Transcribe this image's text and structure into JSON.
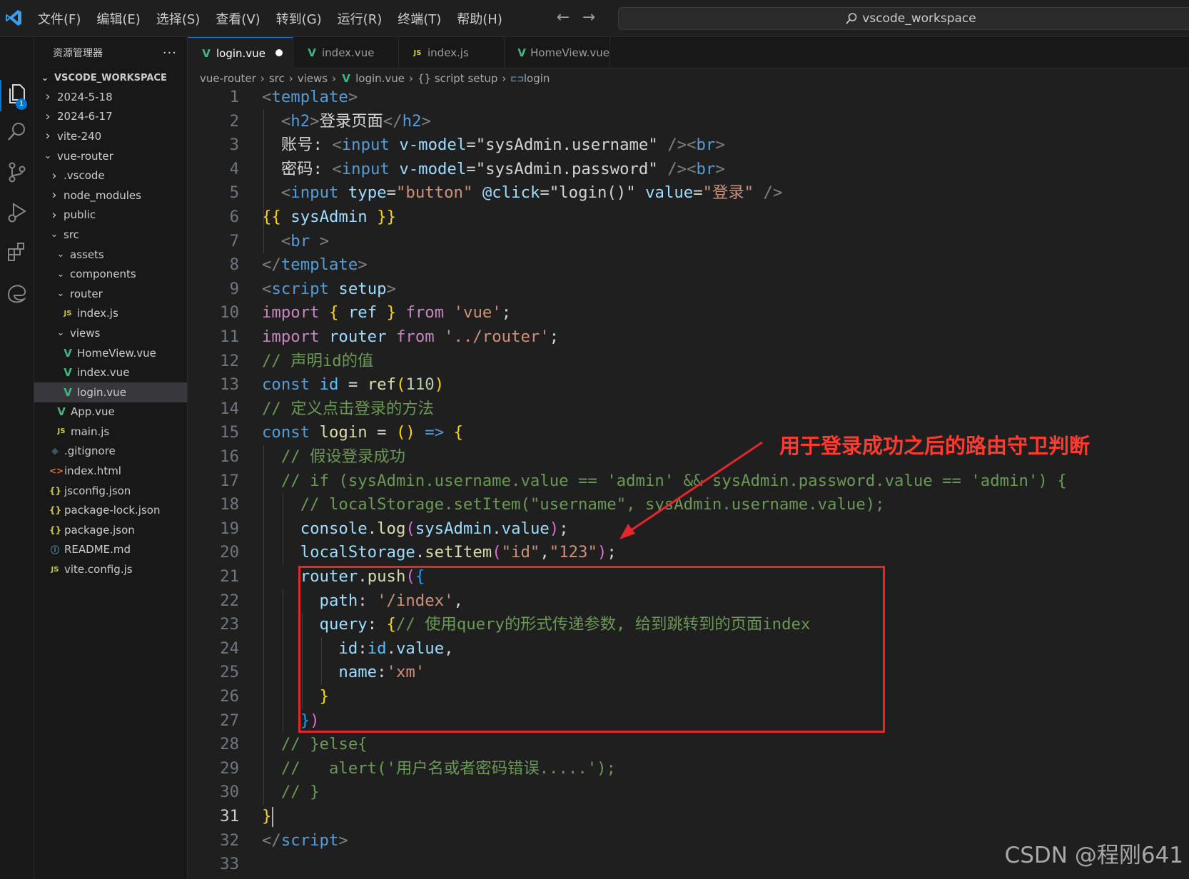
{
  "menu": [
    "文件(F)",
    "编辑(E)",
    "选择(S)",
    "查看(V)",
    "转到(G)",
    "运行(R)",
    "终端(T)",
    "帮助(H)"
  ],
  "search": {
    "text": "vscode_workspace"
  },
  "activity": {
    "explorer_badge": "1"
  },
  "sidebar": {
    "title": "资源管理器",
    "more": "···",
    "workspace": "VSCODE_WORKSPACE",
    "tree": [
      {
        "label": "2024-5-18",
        "depth": 1,
        "chev": "right"
      },
      {
        "label": "2024-6-17",
        "depth": 1,
        "chev": "right"
      },
      {
        "label": "vite-240",
        "depth": 1,
        "chev": "right"
      },
      {
        "label": "vue-router",
        "depth": 1,
        "chev": "down"
      },
      {
        "label": ".vscode",
        "depth": 2,
        "chev": "right"
      },
      {
        "label": "node_modules",
        "depth": 2,
        "chev": "right"
      },
      {
        "label": "public",
        "depth": 2,
        "chev": "right"
      },
      {
        "label": "src",
        "depth": 2,
        "chev": "down"
      },
      {
        "label": "assets",
        "depth": 3,
        "chev": "down"
      },
      {
        "label": "components",
        "depth": 3,
        "chev": "down"
      },
      {
        "label": "router",
        "depth": 3,
        "chev": "down"
      },
      {
        "label": "index.js",
        "depth": 4,
        "icon": "js"
      },
      {
        "label": "views",
        "depth": 3,
        "chev": "down"
      },
      {
        "label": "HomeView.vue",
        "depth": 4,
        "icon": "vue"
      },
      {
        "label": "index.vue",
        "depth": 4,
        "icon": "vue"
      },
      {
        "label": "login.vue",
        "depth": 4,
        "icon": "vue",
        "selected": true
      },
      {
        "label": "App.vue",
        "depth": 3,
        "icon": "vue"
      },
      {
        "label": "main.js",
        "depth": 3,
        "icon": "js"
      },
      {
        "label": ".gitignore",
        "depth": 2,
        "icon": "git"
      },
      {
        "label": "index.html",
        "depth": 2,
        "icon": "html"
      },
      {
        "label": "jsconfig.json",
        "depth": 2,
        "icon": "json"
      },
      {
        "label": "package-lock.json",
        "depth": 2,
        "icon": "json"
      },
      {
        "label": "package.json",
        "depth": 2,
        "icon": "json"
      },
      {
        "label": "README.md",
        "depth": 2,
        "icon": "md"
      },
      {
        "label": "vite.config.js",
        "depth": 2,
        "icon": "js"
      }
    ]
  },
  "tabs": [
    {
      "label": "login.vue",
      "icon": "vue",
      "active": true,
      "dirty": true
    },
    {
      "label": "index.vue",
      "icon": "vue"
    },
    {
      "label": "index.js",
      "icon": "js"
    },
    {
      "label": "HomeView.vue",
      "icon": "vue"
    }
  ],
  "breadcrumb": [
    "vue-router",
    "src",
    "views",
    "login.vue",
    "{} script setup",
    "login"
  ],
  "editor": {
    "current_line": 31,
    "lines": [
      [
        [
          "t-pun",
          "<"
        ],
        [
          "t-tag",
          "template"
        ],
        [
          "t-pun",
          ">"
        ]
      ],
      [
        [
          "",
          "  "
        ],
        [
          "t-pun",
          "<"
        ],
        [
          "t-tag",
          "h2"
        ],
        [
          "t-pun",
          ">"
        ],
        [
          "t-txt",
          "登录页面"
        ],
        [
          "t-pun",
          "</"
        ],
        [
          "t-tag",
          "h2"
        ],
        [
          "t-pun",
          ">"
        ]
      ],
      [
        [
          "",
          "  "
        ],
        [
          "t-txt",
          "账号: "
        ],
        [
          "t-pun",
          "<"
        ],
        [
          "t-tag",
          "input"
        ],
        [
          "t-txt",
          " "
        ],
        [
          "t-attr",
          "v-model"
        ],
        [
          "t-txt",
          "="
        ],
        [
          "t-txt",
          "\"sysAdmin.username\""
        ],
        [
          "t-txt",
          " "
        ],
        [
          "t-pun",
          "/><"
        ],
        [
          "t-tag",
          "br"
        ],
        [
          "t-pun",
          ">"
        ]
      ],
      [
        [
          "",
          "  "
        ],
        [
          "t-txt",
          "密码: "
        ],
        [
          "t-pun",
          "<"
        ],
        [
          "t-tag",
          "input"
        ],
        [
          "t-txt",
          " "
        ],
        [
          "t-attr",
          "v-model"
        ],
        [
          "t-txt",
          "="
        ],
        [
          "t-txt",
          "\"sysAdmin.password\""
        ],
        [
          "t-txt",
          " "
        ],
        [
          "t-pun",
          "/><"
        ],
        [
          "t-tag",
          "br"
        ],
        [
          "t-pun",
          ">"
        ]
      ],
      [
        [
          "",
          "  "
        ],
        [
          "t-pun",
          "<"
        ],
        [
          "t-tag",
          "input"
        ],
        [
          "t-txt",
          " "
        ],
        [
          "t-attr",
          "type"
        ],
        [
          "t-txt",
          "="
        ],
        [
          "t-str",
          "\"button\""
        ],
        [
          "t-txt",
          " "
        ],
        [
          "t-attr",
          "@click"
        ],
        [
          "t-txt",
          "="
        ],
        [
          "t-txt",
          "\"login()\""
        ],
        [
          "t-txt",
          " "
        ],
        [
          "t-attr",
          "value"
        ],
        [
          "t-txt",
          "="
        ],
        [
          "t-str",
          "\"登录\""
        ],
        [
          "t-txt",
          " "
        ],
        [
          "t-pun",
          "/>"
        ]
      ],
      [
        [
          "t-b1",
          "{{"
        ],
        [
          "t-txt",
          " "
        ],
        [
          "t-var",
          "sysAdmin"
        ],
        [
          "t-txt",
          " "
        ],
        [
          "t-b1",
          "}}"
        ]
      ],
      [
        [
          "",
          "  "
        ],
        [
          "t-pun",
          "<"
        ],
        [
          "t-tag",
          "br"
        ],
        [
          "t-txt",
          " "
        ],
        [
          "t-pun",
          ">"
        ]
      ],
      [
        [
          "t-pun",
          "</"
        ],
        [
          "t-tag",
          "template"
        ],
        [
          "t-pun",
          ">"
        ]
      ],
      [
        [
          "t-pun",
          "<"
        ],
        [
          "t-tag",
          "script"
        ],
        [
          "t-txt",
          " "
        ],
        [
          "t-attr",
          "setup"
        ],
        [
          "t-pun",
          ">"
        ]
      ],
      [
        [
          "t-kw",
          "import"
        ],
        [
          "t-txt",
          " "
        ],
        [
          "t-b1",
          "{"
        ],
        [
          "t-txt",
          " "
        ],
        [
          "t-var",
          "ref"
        ],
        [
          "t-txt",
          " "
        ],
        [
          "t-b1",
          "}"
        ],
        [
          "t-txt",
          " "
        ],
        [
          "t-kw",
          "from"
        ],
        [
          "t-txt",
          " "
        ],
        [
          "t-str",
          "'vue'"
        ],
        [
          "t-txt",
          ";"
        ]
      ],
      [
        [
          "t-kw",
          "import"
        ],
        [
          "t-txt",
          " "
        ],
        [
          "t-var",
          "router"
        ],
        [
          "t-txt",
          " "
        ],
        [
          "t-kw",
          "from"
        ],
        [
          "t-txt",
          " "
        ],
        [
          "t-str",
          "'../router'"
        ],
        [
          "t-txt",
          ";"
        ]
      ],
      [
        [
          "t-com",
          "// 声明id的值"
        ]
      ],
      [
        [
          "t-key",
          "const"
        ],
        [
          "t-txt",
          " "
        ],
        [
          "t-const",
          "id"
        ],
        [
          "t-txt",
          " = "
        ],
        [
          "t-fn",
          "ref"
        ],
        [
          "t-b1",
          "("
        ],
        [
          "t-num",
          "110"
        ],
        [
          "t-b1",
          ")"
        ]
      ],
      [
        [
          "t-com",
          "// 定义点击登录的方法"
        ]
      ],
      [
        [
          "t-key",
          "const"
        ],
        [
          "t-txt",
          " "
        ],
        [
          "t-fn",
          "login"
        ],
        [
          "t-txt",
          " = "
        ],
        [
          "t-b1",
          "()"
        ],
        [
          "t-txt",
          " "
        ],
        [
          "t-key",
          "=>"
        ],
        [
          "t-txt",
          " "
        ],
        [
          "t-b1",
          "{"
        ]
      ],
      [
        [
          "",
          "  "
        ],
        [
          "t-com",
          "// 假设登录成功"
        ]
      ],
      [
        [
          "",
          "  "
        ],
        [
          "t-com",
          "// if (sysAdmin.username.value == 'admin' && sysAdmin.password.value == 'admin') {"
        ]
      ],
      [
        [
          "",
          "    "
        ],
        [
          "t-com",
          "// localStorage.setItem(\"username\", sysAdmin.username.value);"
        ]
      ],
      [
        [
          "",
          "    "
        ],
        [
          "t-var",
          "console"
        ],
        [
          "t-txt",
          "."
        ],
        [
          "t-fn",
          "log"
        ],
        [
          "t-b2",
          "("
        ],
        [
          "t-var",
          "sysAdmin"
        ],
        [
          "t-txt",
          "."
        ],
        [
          "t-var",
          "value"
        ],
        [
          "t-b2",
          ")"
        ],
        [
          "t-txt",
          ";"
        ]
      ],
      [
        [
          "",
          "    "
        ],
        [
          "t-var",
          "localStorage"
        ],
        [
          "t-txt",
          "."
        ],
        [
          "t-fn",
          "setItem"
        ],
        [
          "t-b2",
          "("
        ],
        [
          "t-str",
          "\"id\""
        ],
        [
          "t-txt",
          ","
        ],
        [
          "t-str",
          "\"123\""
        ],
        [
          "t-b2",
          ")"
        ],
        [
          "t-txt",
          ";"
        ]
      ],
      [
        [
          "",
          "    "
        ],
        [
          "t-var",
          "router"
        ],
        [
          "t-txt",
          "."
        ],
        [
          "t-fn",
          "push"
        ],
        [
          "t-b2",
          "("
        ],
        [
          "t-b3",
          "{"
        ]
      ],
      [
        [
          "",
          "      "
        ],
        [
          "t-var",
          "path"
        ],
        [
          "t-txt",
          ": "
        ],
        [
          "t-str",
          "'/index'"
        ],
        [
          "t-txt",
          ","
        ]
      ],
      [
        [
          "",
          "      "
        ],
        [
          "t-var",
          "query"
        ],
        [
          "t-txt",
          ": "
        ],
        [
          "t-b1",
          "{"
        ],
        [
          "t-com",
          "// 使用query的形式传递参数, 给到跳转到的页面index"
        ]
      ],
      [
        [
          "",
          "        "
        ],
        [
          "t-var",
          "id"
        ],
        [
          "t-txt",
          ":"
        ],
        [
          "t-const",
          "id"
        ],
        [
          "t-txt",
          "."
        ],
        [
          "t-var",
          "value"
        ],
        [
          "t-txt",
          ","
        ]
      ],
      [
        [
          "",
          "        "
        ],
        [
          "t-var",
          "name"
        ],
        [
          "t-txt",
          ":"
        ],
        [
          "t-str",
          "'xm'"
        ]
      ],
      [
        [
          "",
          "      "
        ],
        [
          "t-b1",
          "}"
        ]
      ],
      [
        [
          "",
          "    "
        ],
        [
          "t-b3",
          "}"
        ],
        [
          "t-b2",
          ")"
        ]
      ],
      [
        [
          "",
          "  "
        ],
        [
          "t-com",
          "// }else{"
        ]
      ],
      [
        [
          "",
          "  "
        ],
        [
          "t-com",
          "//   alert('用户名或者密码错误.....');"
        ]
      ],
      [
        [
          "",
          "  "
        ],
        [
          "t-com",
          "// }"
        ]
      ],
      [
        [
          "t-b1",
          "}"
        ]
      ],
      [
        [
          "t-pun",
          "</"
        ],
        [
          "t-tag",
          "script"
        ],
        [
          "t-pun",
          ">"
        ]
      ],
      [
        [
          "",
          ""
        ]
      ]
    ]
  },
  "annotation": {
    "label": "用于登录成功之后的路由守卫判断",
    "color": "#ff3b30"
  },
  "watermark": "CSDN @程刚641"
}
